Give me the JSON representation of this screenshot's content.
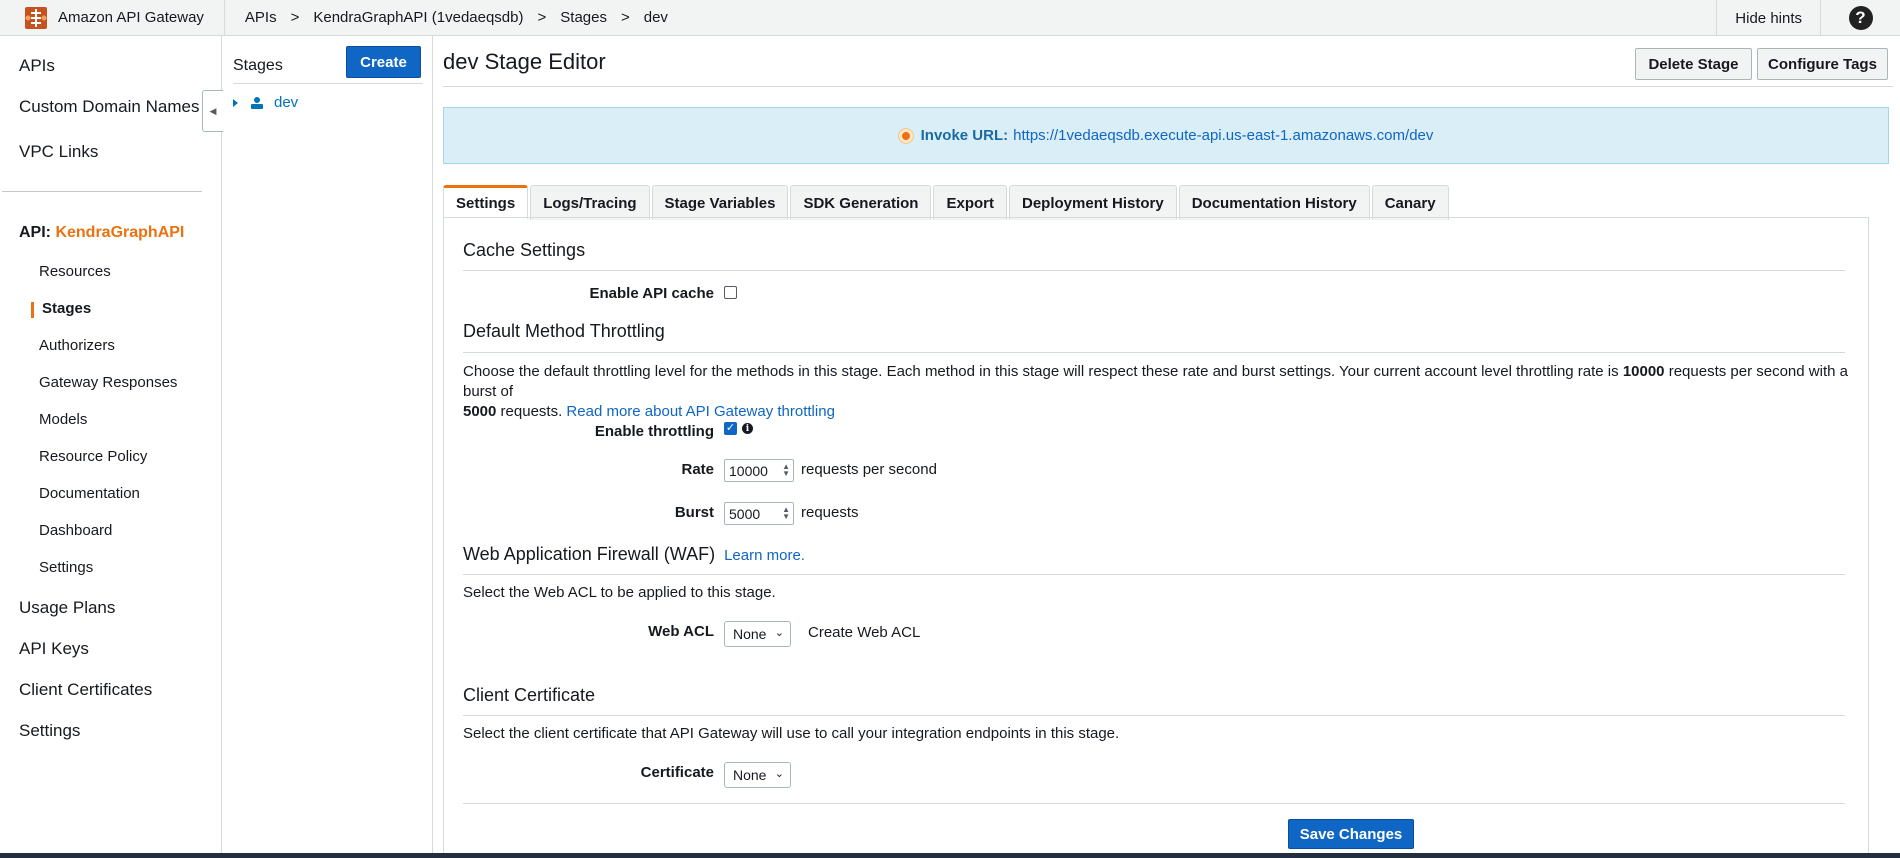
{
  "app": {
    "title": "Amazon API Gateway"
  },
  "breadcrumbs": [
    "APIs",
    "KendraGraphAPI (1vedaeqsdb)",
    "Stages",
    "dev"
  ],
  "breadcrumb_sep": ">",
  "topbar": {
    "hints_label": "Hide hints",
    "help_label": "?"
  },
  "leftnav": {
    "top_items": [
      "APIs",
      "Custom Domain Names",
      "VPC Links"
    ],
    "api_prefix": "API:",
    "api_name": "KendraGraphAPI",
    "sub_items": [
      "Resources",
      "Stages",
      "Authorizers",
      "Gateway Responses",
      "Models",
      "Resource Policy",
      "Documentation",
      "Dashboard",
      "Settings"
    ],
    "active_item": "Stages",
    "bottom_items": [
      "Usage Plans",
      "API Keys",
      "Client Certificates",
      "Settings"
    ]
  },
  "stages_panel": {
    "title": "Stages",
    "create_label": "Create",
    "stage": "dev"
  },
  "main": {
    "title": "dev Stage Editor",
    "delete_label": "Delete Stage",
    "tags_label": "Configure Tags",
    "invoke_label": "Invoke URL:",
    "invoke_url": "https://1vedaeqsdb.execute-api.us-east-1.amazonaws.com/dev",
    "tabs": [
      "Settings",
      "Logs/Tracing",
      "Stage Variables",
      "SDK Generation",
      "Export",
      "Deployment History",
      "Documentation History",
      "Canary"
    ],
    "active_tab": "Settings"
  },
  "cache": {
    "title": "Cache Settings",
    "enable_label": "Enable API cache",
    "enabled": false
  },
  "throttling": {
    "title": "Default Method Throttling",
    "desc_1": "Choose the default throttling level for the methods in this stage. Each method in this stage will respect these rate and burst settings. Your current account level throttling rate is ",
    "rate_bold": "10000",
    "desc_2": " requests per second with a burst of",
    "burst_bold": "5000",
    "desc_3": " requests. ",
    "read_more": "Read more about API Gateway throttling",
    "enable_label": "Enable throttling",
    "enabled": true,
    "info_label": "i",
    "rate_label": "Rate",
    "rate_value": "10000",
    "rate_unit": "requests per second",
    "burst_label": "Burst",
    "burst_value": "5000",
    "burst_unit": "requests"
  },
  "waf": {
    "title": "Web Application Firewall (WAF)",
    "learn_more": "Learn more.",
    "desc": "Select the Web ACL to be applied to this stage.",
    "acl_label": "Web ACL",
    "acl_value": "None",
    "create_link": "Create Web ACL"
  },
  "client_cert": {
    "title": "Client Certificate",
    "desc": "Select the client certificate that API Gateway will use to call your integration endpoints in this stage.",
    "cert_label": "Certificate",
    "cert_value": "None"
  },
  "save_label": "Save Changes",
  "colors": {
    "accent": "#ec7211",
    "primary": "#0f66c4",
    "link": "#0073bb",
    "invoke_bg": "#d9eef7"
  }
}
